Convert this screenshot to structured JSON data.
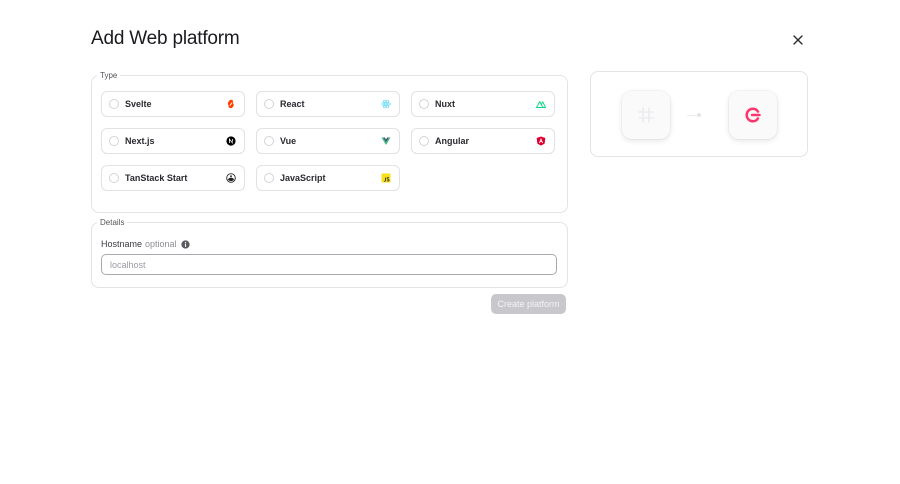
{
  "dialog": {
    "title": "Add Web platform"
  },
  "type_group": {
    "legend": "Type",
    "options": [
      {
        "label": "Svelte",
        "icon": "svelte-icon",
        "color": "#ff3e00"
      },
      {
        "label": "React",
        "icon": "react-icon",
        "color": "#61dafb"
      },
      {
        "label": "Nuxt",
        "icon": "nuxt-icon",
        "color": "#00dc82"
      },
      {
        "label": "Next.js",
        "icon": "nextjs-icon",
        "color": "#000000"
      },
      {
        "label": "Vue",
        "icon": "vue-icon",
        "color": "#41b883"
      },
      {
        "label": "Angular",
        "icon": "angular-icon",
        "color": "#dd0031"
      },
      {
        "label": "TanStack Start",
        "icon": "tanstack-icon",
        "color": "#222222"
      },
      {
        "label": "JavaScript",
        "icon": "javascript-icon",
        "color": "#f7df1e"
      }
    ]
  },
  "details_group": {
    "legend": "Details",
    "hostname_label": "Hostname",
    "hostname_optional": "optional",
    "hostname_placeholder": "localhost",
    "hostname_value": ""
  },
  "actions": {
    "create_label": "Create platform"
  },
  "preview": {
    "accent": "#fd366e"
  }
}
